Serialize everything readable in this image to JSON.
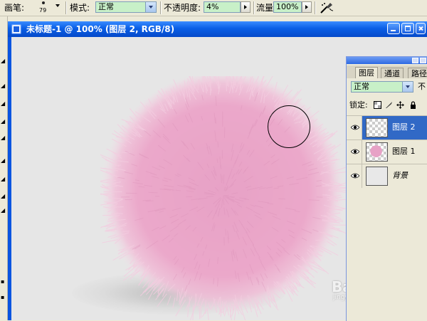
{
  "options_bar": {
    "brush_label": "画笔:",
    "brush_size": "79",
    "mode_label": "模式:",
    "mode_value": "正常",
    "opacity_label": "不透明度:",
    "opacity_value": "4%",
    "flow_label": "流量:",
    "flow_value": "100%"
  },
  "document": {
    "title": "未标题-1 @ 100% (图层 2, RGB/8)"
  },
  "layers_panel": {
    "tabs": [
      "图层",
      "通道",
      "路径"
    ],
    "blend_mode": "正常",
    "opacity_label": "不",
    "lock_label": "锁定:",
    "layers": [
      {
        "name": "图层 2",
        "selected": true
      },
      {
        "name": "图层 1",
        "selected": false
      },
      {
        "name": "背景",
        "selected": false
      }
    ]
  },
  "watermark": {
    "logo": "Baidu 经验",
    "url": "jingyan.baidu.com"
  },
  "colors": {
    "fur": "#e9a3c7",
    "titlebar": "#0a5fe6",
    "selection": "#3169c6",
    "input_bg": "#c8f0c8"
  }
}
